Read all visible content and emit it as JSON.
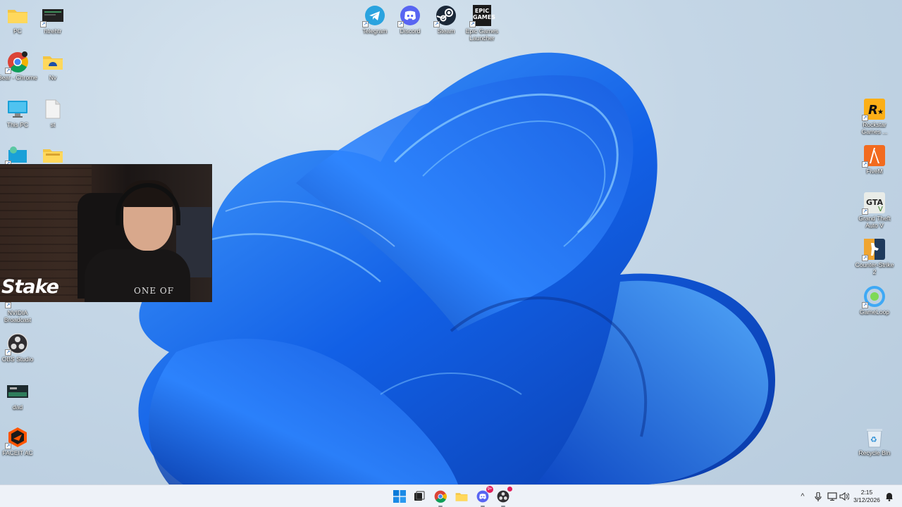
{
  "desktop": {
    "left_icons": [
      {
        "label": "PC",
        "icon": "folder-icon"
      },
      {
        "label": "htrehtr",
        "icon": "app-window-icon"
      },
      {
        "label": "Bear - Chrome",
        "icon": "chrome-icon"
      },
      {
        "label": "Nv",
        "icon": "folder-icon"
      },
      {
        "label": "This PC",
        "icon": "monitor-icon"
      },
      {
        "label": "st",
        "icon": "file-icon"
      },
      {
        "label": "",
        "icon": "network-icon"
      },
      {
        "label": "",
        "icon": "folder-icon"
      },
      {
        "label": "NVIDIA Broadcast",
        "icon": "nvidia-broadcast-icon"
      },
      {
        "label": "OBS Studio",
        "icon": "obs-icon"
      },
      {
        "label": "dad",
        "icon": "app-window-icon"
      },
      {
        "label": "FACEIT AC",
        "icon": "faceit-icon"
      }
    ],
    "top_icons": [
      {
        "label": "Telegram",
        "icon": "telegram-icon"
      },
      {
        "label": "Discord",
        "icon": "discord-icon"
      },
      {
        "label": "Steam",
        "icon": "steam-icon"
      },
      {
        "label": "Epic Games Launcher",
        "icon": "epic-games-icon",
        "logo_text": "EPIC GAMES"
      }
    ],
    "right_icons": [
      {
        "label": "Rockstar Games ...",
        "icon": "rockstar-icon"
      },
      {
        "label": "FiveM",
        "icon": "fivem-icon"
      },
      {
        "label": "Grand Theft Auto V",
        "icon": "gta-icon"
      },
      {
        "label": "Counter-Strike 2",
        "icon": "cs2-icon"
      },
      {
        "label": "GameLoop",
        "icon": "gameloop-icon"
      },
      {
        "label": "Recycle Bin",
        "icon": "recycle-bin-icon"
      }
    ]
  },
  "webcam": {
    "overlay_text": "Stake",
    "shirt_text": "ONE OF"
  },
  "taskbar": {
    "apps": [
      {
        "name": "start",
        "icon": "windows-start-icon"
      },
      {
        "name": "task-view",
        "icon": "task-view-icon"
      },
      {
        "name": "chrome",
        "icon": "chrome-icon"
      },
      {
        "name": "file-explorer",
        "icon": "folder-icon"
      },
      {
        "name": "discord",
        "icon": "discord-icon",
        "badge": "9+"
      },
      {
        "name": "obs",
        "icon": "obs-icon"
      }
    ],
    "tray": {
      "chevron": "^",
      "time": "2:15",
      "date": "3/12/2026"
    }
  },
  "colors": {
    "wallpaper_blue": "#1f6fe0",
    "taskbar_bg": "#eef2f8",
    "discord": "#5865f2",
    "telegram": "#2aa3df"
  }
}
